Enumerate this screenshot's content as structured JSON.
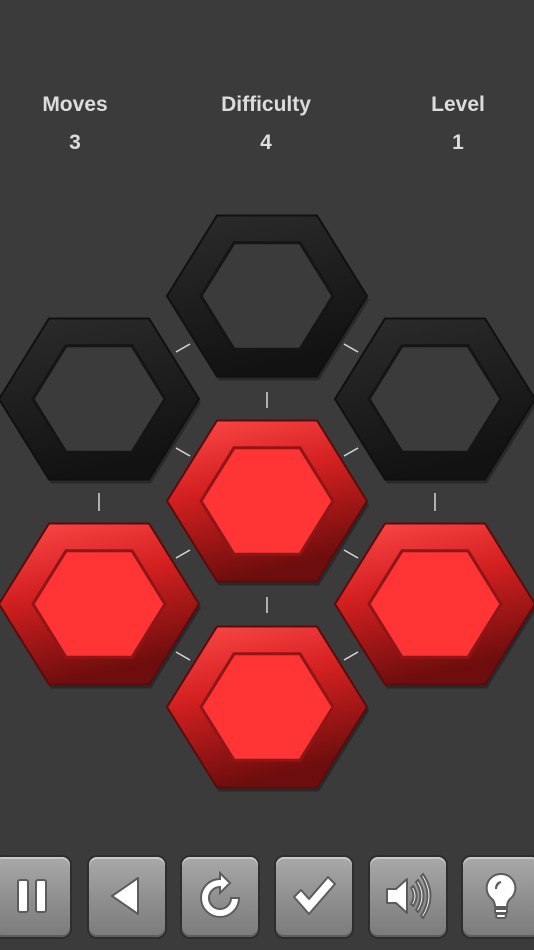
{
  "stats": {
    "moves_label": "Moves",
    "moves_value": "3",
    "difficulty_label": "Difficulty",
    "difficulty_value": "4",
    "level_label": "Level",
    "level_value": "1"
  },
  "board": {
    "tiles": [
      {
        "id": "top",
        "state": "dark"
      },
      {
        "id": "upper-left",
        "state": "dark"
      },
      {
        "id": "upper-right",
        "state": "dark"
      },
      {
        "id": "center",
        "state": "red"
      },
      {
        "id": "lower-left",
        "state": "red"
      },
      {
        "id": "lower-right",
        "state": "red"
      },
      {
        "id": "bottom",
        "state": "red"
      }
    ],
    "colors": {
      "red_face": "#ff3434",
      "red_frame": "#c01d1d",
      "dark_frame": "#222222",
      "background": "#3b3b3b"
    }
  },
  "toolbar": {
    "buttons": [
      {
        "id": "pause",
        "icon": "pause-icon"
      },
      {
        "id": "back",
        "icon": "back-arrow-icon"
      },
      {
        "id": "restart",
        "icon": "restart-icon"
      },
      {
        "id": "check",
        "icon": "checkmark-icon"
      },
      {
        "id": "sound",
        "icon": "speaker-icon"
      },
      {
        "id": "hint",
        "icon": "lightbulb-icon"
      }
    ]
  }
}
